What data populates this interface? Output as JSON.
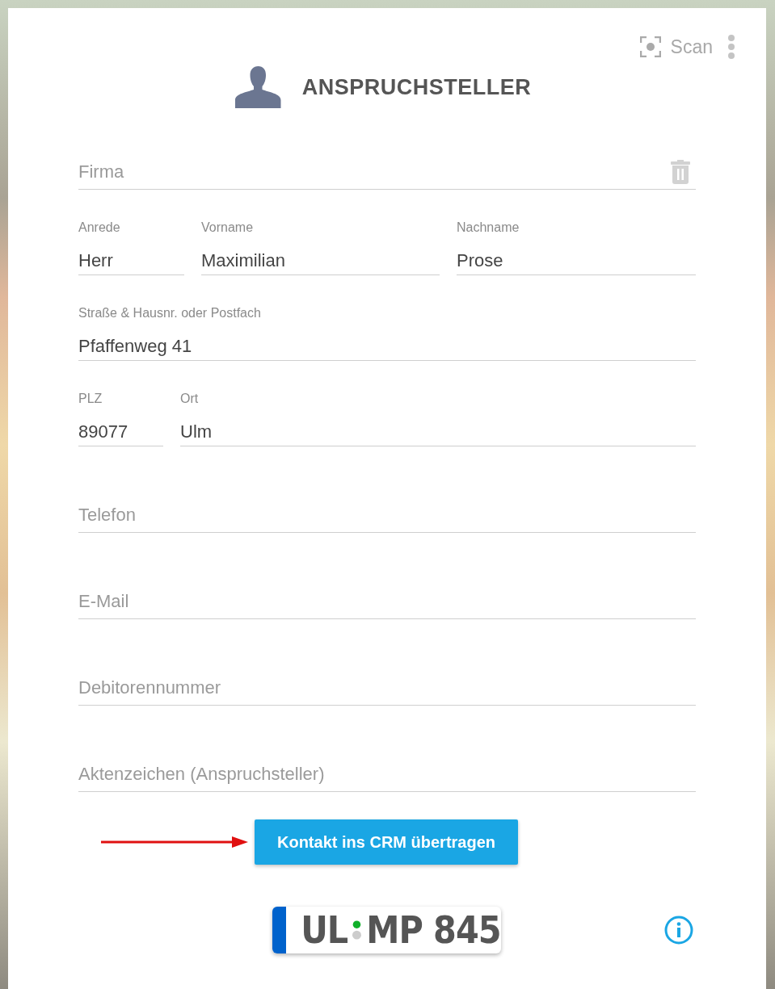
{
  "toolbar": {
    "scan_label": "Scan"
  },
  "header": {
    "title": "ANSPRUCHSTELLER"
  },
  "form_rows": [
    {
      "fields": [
        {
          "kind": "placeholder",
          "placeholder": "Firma",
          "deletable": true
        }
      ]
    },
    {
      "fields": [
        {
          "kind": "filled",
          "label": "Anrede",
          "value": "Herr"
        },
        {
          "kind": "filled",
          "label": "Vorname",
          "value": "Maximilian"
        },
        {
          "kind": "filled",
          "label": "Nachname",
          "value": "Prose"
        }
      ]
    },
    {
      "fields": [
        {
          "kind": "filled",
          "label": "Straße & Hausnr. oder Postfach",
          "value": "Pfaffenweg 41"
        }
      ]
    },
    {
      "fields": [
        {
          "kind": "filled",
          "label": "PLZ",
          "value": "89077"
        },
        {
          "kind": "filled",
          "label": "Ort",
          "value": "Ulm"
        }
      ]
    },
    {
      "fields": [
        {
          "kind": "placeholder",
          "placeholder": "Telefon"
        }
      ]
    },
    {
      "fields": [
        {
          "kind": "placeholder",
          "placeholder": "E-Mail"
        }
      ]
    },
    {
      "fields": [
        {
          "kind": "placeholder",
          "placeholder": "Debitorennummer"
        }
      ]
    },
    {
      "fields": [
        {
          "kind": "placeholder",
          "placeholder": "Aktenzeichen (Anspruchsteller)"
        }
      ]
    }
  ],
  "action": {
    "label": "Kontakt ins CRM übertragen",
    "annotated": true
  },
  "plate": {
    "district": "UL",
    "number": "MP 845"
  }
}
